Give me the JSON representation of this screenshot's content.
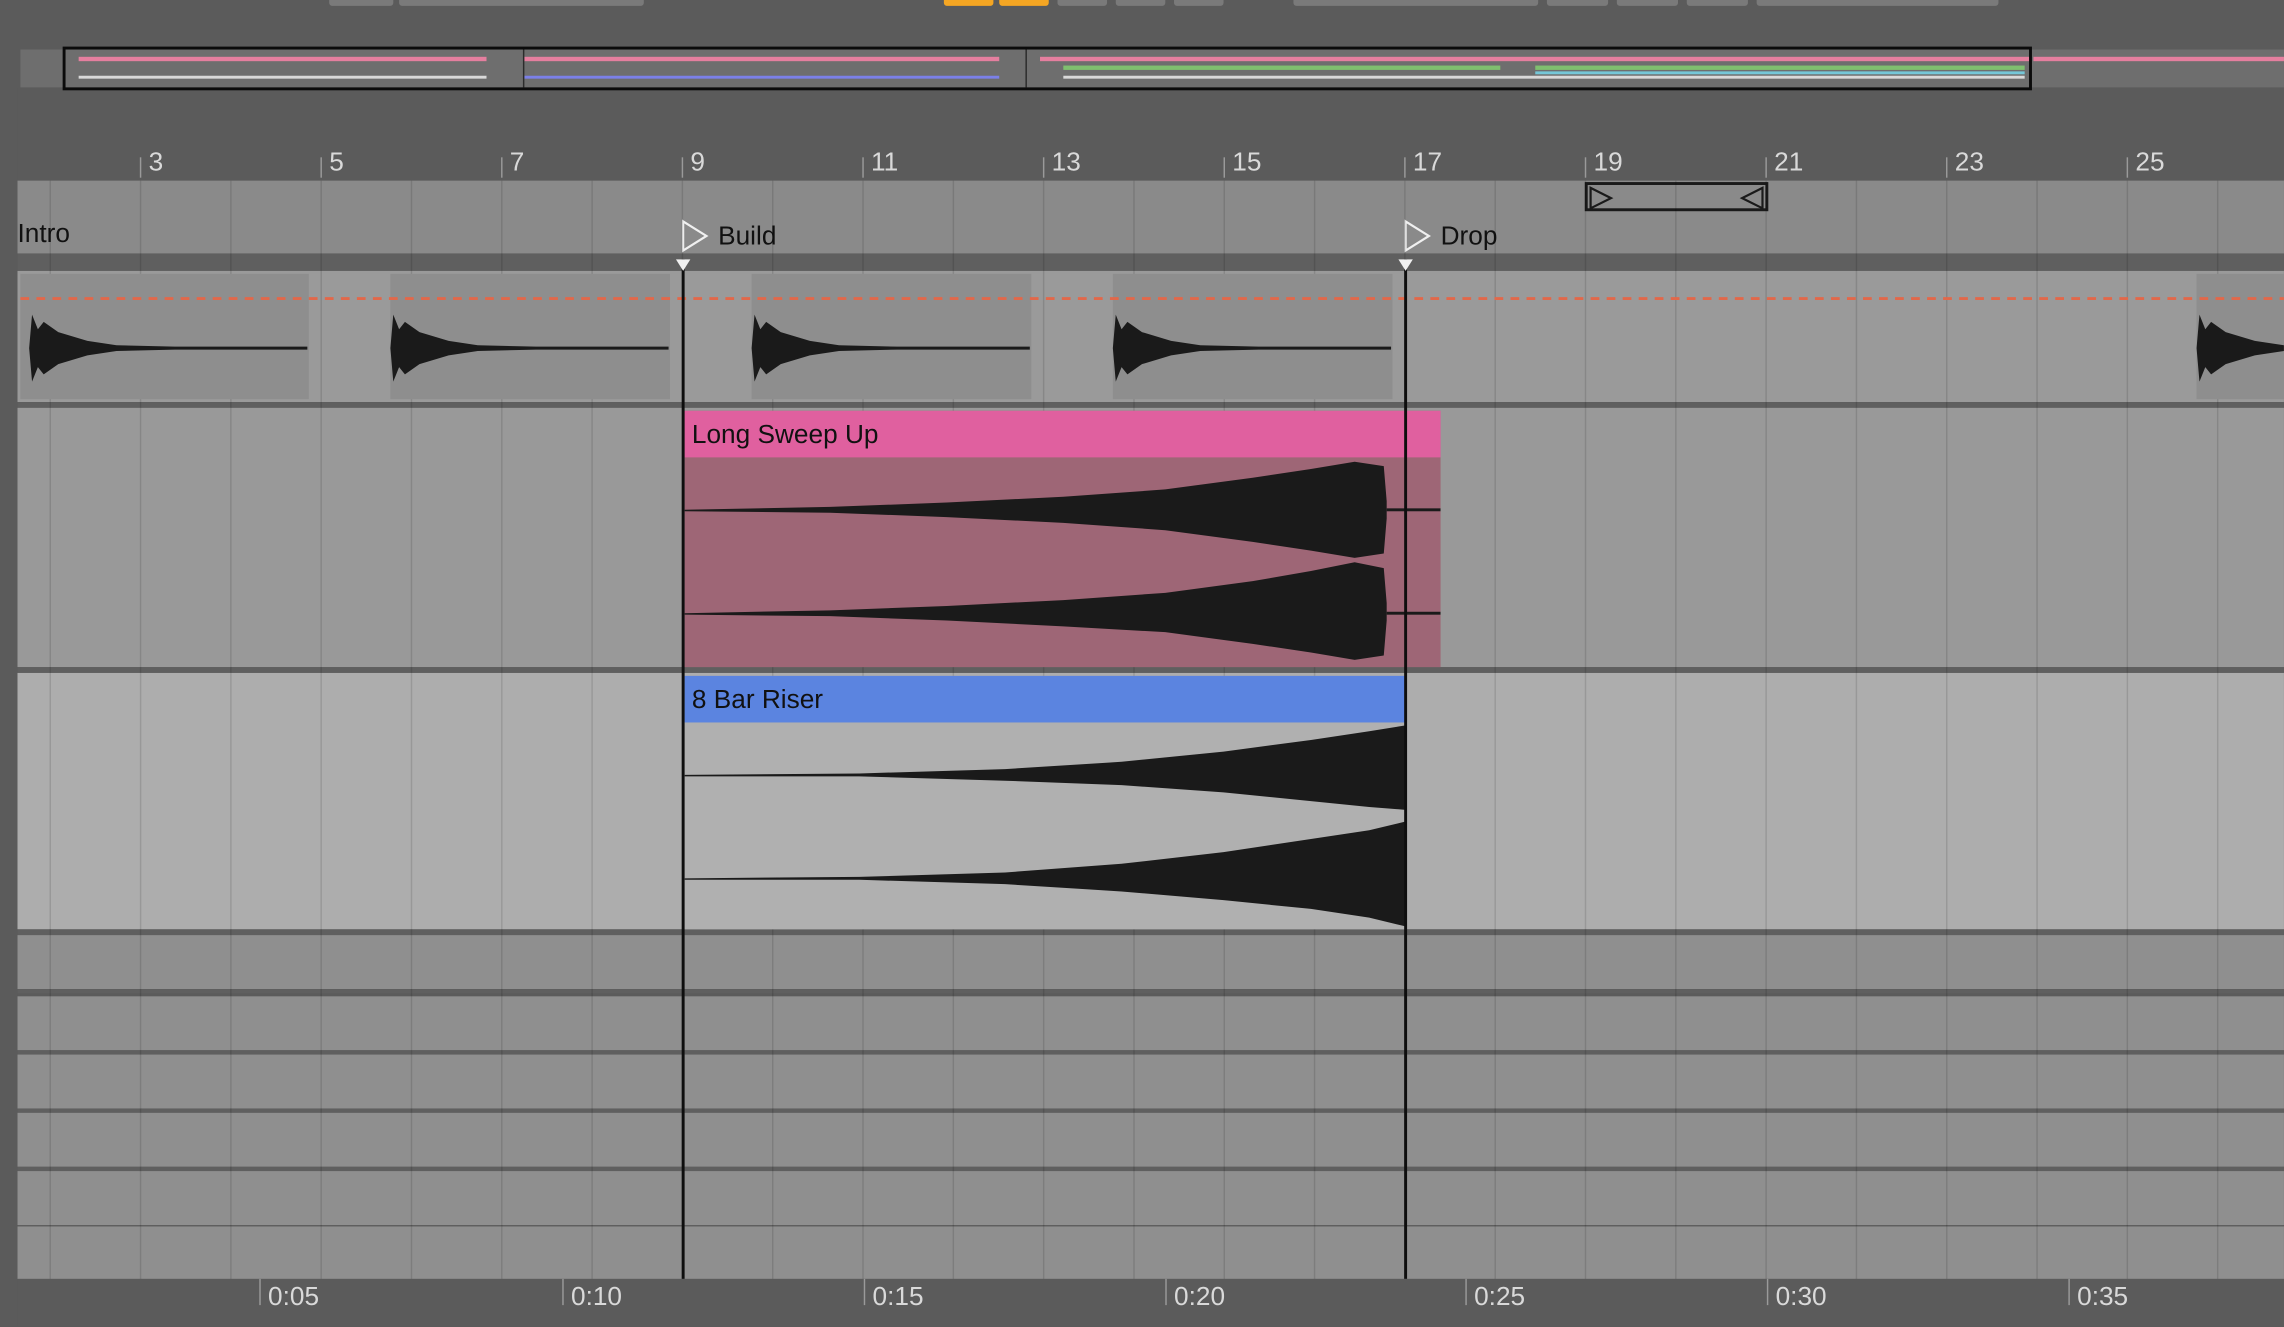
{
  "ruler": {
    "bars": [
      "3",
      "5",
      "7",
      "9",
      "11",
      "13",
      "15",
      "17",
      "19",
      "21",
      "23",
      "25"
    ]
  },
  "locators": {
    "intro": "Intro",
    "build": "Build",
    "drop": "Drop"
  },
  "clips": {
    "long_sweep_up": {
      "name": "Long Sweep Up",
      "color": "#e0609f"
    },
    "eight_bar_riser": {
      "name": "8 Bar Riser",
      "color": "#5b84e0"
    }
  },
  "time_ruler": {
    "labels": [
      "0:05",
      "0:10",
      "0:15",
      "0:20",
      "0:25",
      "0:30",
      "0:35"
    ]
  },
  "colors": {
    "automation_line": "#e2684a",
    "toolbar_active": "#f5a623"
  }
}
